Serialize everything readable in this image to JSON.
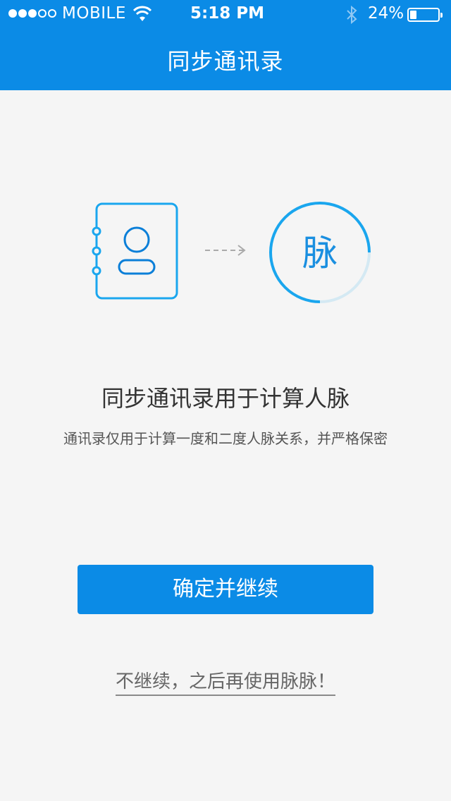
{
  "status_bar": {
    "carrier": "MOBILE",
    "time": "5:18 PM",
    "battery_percent": "24%",
    "battery_level": 0.24,
    "signal_strength": 3,
    "signal_max": 5,
    "icons": [
      "signal-dots-icon",
      "wifi-icon",
      "bluetooth-icon",
      "battery-icon"
    ]
  },
  "nav": {
    "title": "同步通讯录"
  },
  "illustration": {
    "icons": [
      "contacts-book-icon",
      "arrow-right-icon",
      "maimai-logo-icon"
    ],
    "logo_char": "脉",
    "accent": "#1aa6ee"
  },
  "main": {
    "headline": "同步通讯录用于计算人脉",
    "subtext": "通讯录仅用于计算一度和二度人脉关系，并严格保密"
  },
  "actions": {
    "confirm_label": "确定并继续",
    "skip_label": "不继续，之后再使用脉脉！"
  },
  "colors": {
    "primary": "#0b8be6",
    "background": "#f5f5f5",
    "text_dark": "#333333",
    "text_muted": "#555555"
  }
}
